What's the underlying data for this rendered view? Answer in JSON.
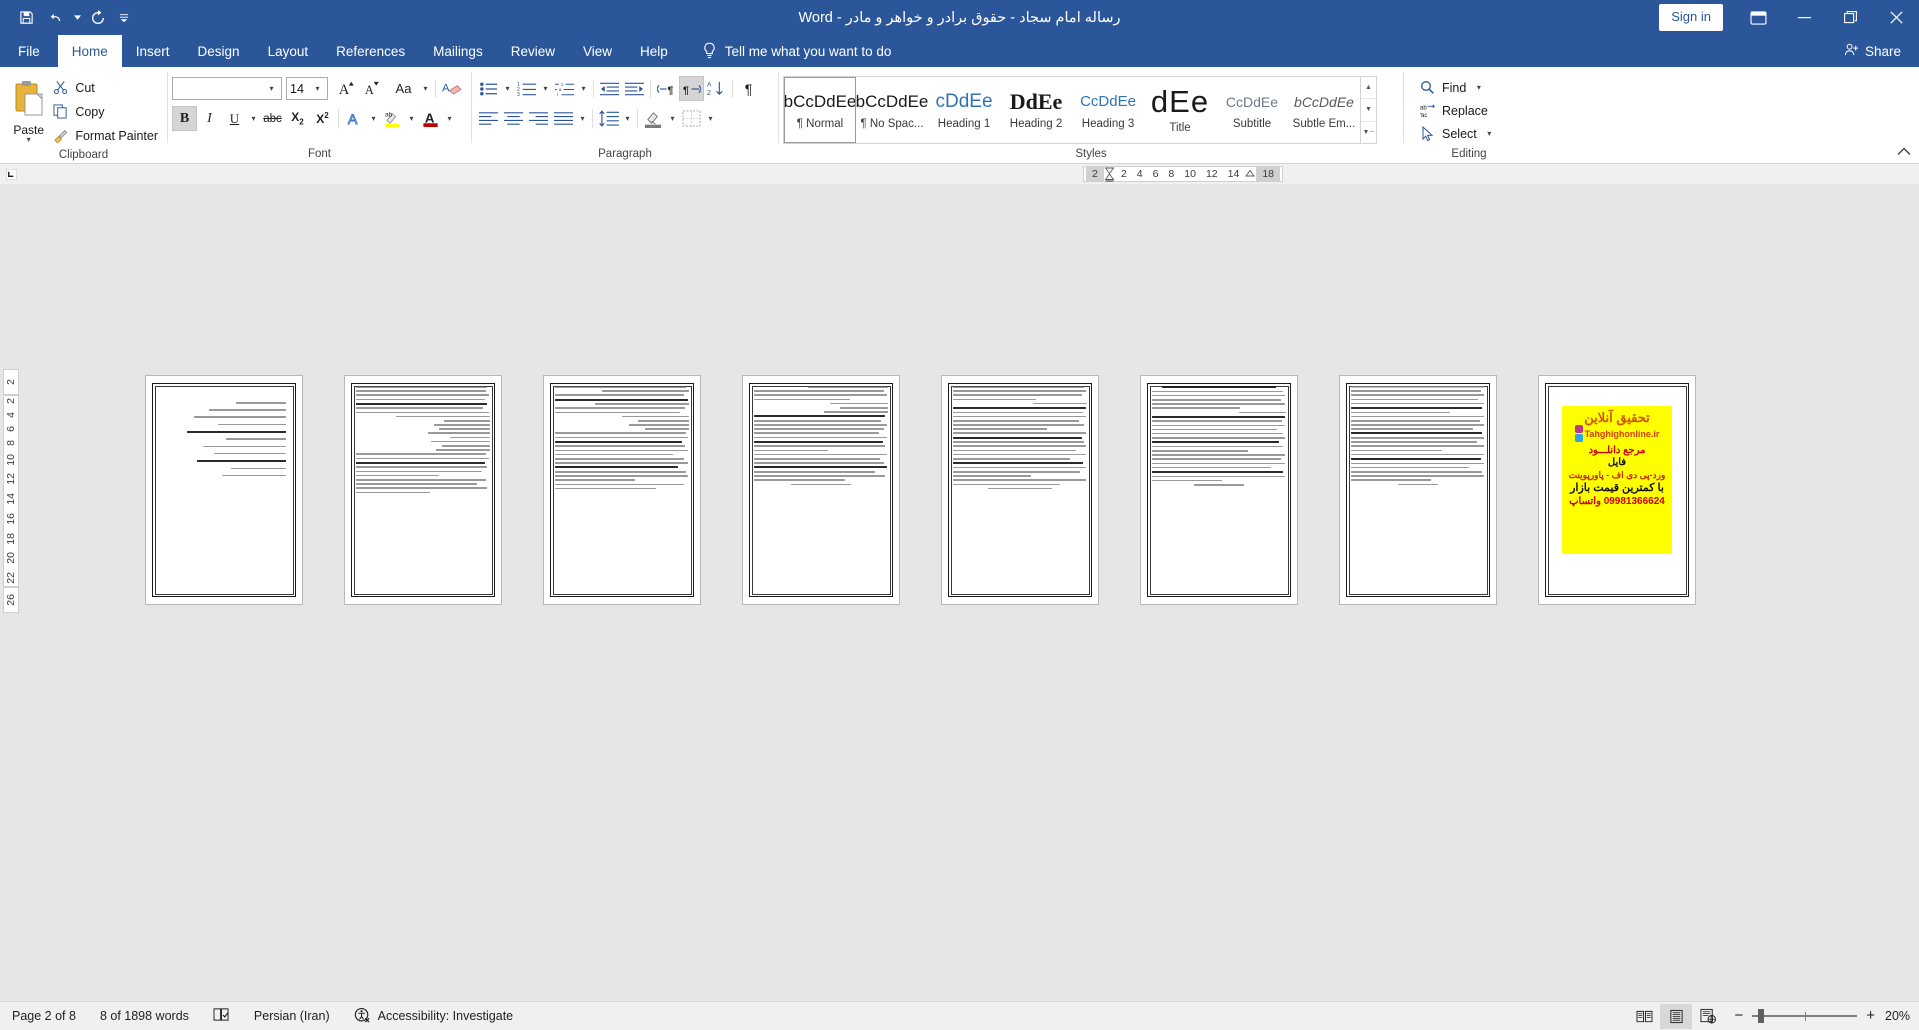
{
  "titlebar": {
    "document_title": "رساله امام سجاد - حقوق برادر و خواهر و مادر  -  Word",
    "quick_access": [
      {
        "name": "save-icon",
        "label": "Save"
      },
      {
        "name": "undo-icon",
        "label": "Undo"
      },
      {
        "name": "redo-icon",
        "label": "Redo"
      },
      {
        "name": "customize-qat-icon",
        "label": "Customize Quick Access Toolbar"
      }
    ],
    "sign_in": "Sign in",
    "ribbon_display_options": "Ribbon Display Options",
    "minimize": "Minimize",
    "restore": "Restore Down",
    "close": "Close"
  },
  "tabs": [
    {
      "label": "File",
      "active": false
    },
    {
      "label": "Home",
      "active": true
    },
    {
      "label": "Insert",
      "active": false
    },
    {
      "label": "Design",
      "active": false
    },
    {
      "label": "Layout",
      "active": false
    },
    {
      "label": "References",
      "active": false
    },
    {
      "label": "Mailings",
      "active": false
    },
    {
      "label": "Review",
      "active": false
    },
    {
      "label": "View",
      "active": false
    },
    {
      "label": "Help",
      "active": false
    }
  ],
  "tell_me": "Tell me what you want to do",
  "share": "Share",
  "ribbon": {
    "clipboard": {
      "group_label": "Clipboard",
      "paste": "Paste",
      "cut": "Cut",
      "copy": "Copy",
      "format_painter": "Format Painter"
    },
    "font": {
      "group_label": "Font",
      "font_name_value": "",
      "font_name_placeholder": "",
      "font_size_value": "14",
      "grow_font": "Increase Font Size",
      "shrink_font": "Decrease Font Size",
      "change_case": "Aa",
      "clear_formatting": "Clear All Formatting",
      "bold": "B",
      "italic": "I",
      "underline": "U",
      "strikethrough": "abc",
      "subscript": "X₂",
      "superscript": "X²",
      "text_effects": "A",
      "highlight": "Text Highlight Color",
      "font_color": "A"
    },
    "paragraph": {
      "group_label": "Paragraph",
      "bullets": "Bullets",
      "numbering": "Numbering",
      "multilevel": "Multilevel List",
      "decrease_indent": "Decrease Indent",
      "increase_indent": "Increase Indent",
      "ltr_text": "Left-to-Right Text Direction",
      "rtl_text": "Right-to-Left Text Direction",
      "sort": "Sort",
      "show_marks": "Show/Hide ¶",
      "align_left": "Align Left",
      "align_center": "Center",
      "align_right": "Align Right",
      "justify": "Justify",
      "line_spacing": "Line and Paragraph Spacing",
      "shading": "Shading",
      "borders": "Borders"
    },
    "styles": {
      "group_label": "Styles",
      "items": [
        {
          "preview": "bCcDdEe",
          "name": "¶ Normal",
          "selected": true
        },
        {
          "preview": "bCcDdEe",
          "name": "¶ No Spac...",
          "selected": false
        },
        {
          "preview": "cDdEe",
          "name": "Heading 1",
          "selected": false
        },
        {
          "preview": "DdEe",
          "name": "Heading 2",
          "selected": false
        },
        {
          "preview": "CcDdEe",
          "name": "Heading 3",
          "selected": false
        },
        {
          "preview": "dEe",
          "name": "Title",
          "selected": false
        },
        {
          "preview": "CcDdEe",
          "name": "Subtitle",
          "selected": false
        },
        {
          "preview": "bCcDdEe",
          "name": "Subtle Em...",
          "selected": false
        }
      ]
    },
    "editing": {
      "group_label": "Editing",
      "find": "Find",
      "replace": "Replace",
      "select": "Select"
    },
    "collapse_ribbon": "Collapse the Ribbon"
  },
  "ruler": {
    "horizontal_ticks": [
      "18",
      "14",
      "12",
      "10",
      "8",
      "6",
      "4",
      "2",
      "2"
    ],
    "vertical_ticks_top": [
      "2"
    ],
    "vertical_ticks": [
      "2",
      "4",
      "6",
      "8",
      "10",
      "12",
      "14",
      "16",
      "18",
      "20",
      "22"
    ],
    "vertical_ticks_bottom": [
      "26"
    ],
    "tab_stop_selector": "Left Tab"
  },
  "document": {
    "page_count_visible": 8,
    "pages": [
      {
        "page_label": "",
        "type": "text"
      },
      {
        "page_label": "",
        "type": "text"
      },
      {
        "page_label": "",
        "type": "text"
      },
      {
        "page_label": "",
        "type": "text"
      },
      {
        "page_label": "",
        "type": "text"
      },
      {
        "page_label": "",
        "type": "text"
      },
      {
        "page_label": "",
        "type": "text"
      },
      {
        "page_label": "",
        "type": "ad"
      }
    ],
    "ad_page": {
      "line1": "تحقیق آنلاین",
      "line2": "Tahghighonline.ir",
      "line3": "مرجع دانلـــود",
      "line4": "فایل",
      "line5": "ورد-پی دی اف - پاورپوینت",
      "line6": "با کمترین قیمت بازار",
      "line7": "09981366624 واتساپ",
      "background_color": "#ffff00"
    }
  },
  "statusbar": {
    "page": "Page 2 of 8",
    "words": "8 of 1898 words",
    "proofing": "Proofing errors",
    "language": "Persian (Iran)",
    "accessibility": "Accessibility: Investigate",
    "views": [
      {
        "name": "read-mode",
        "label": "Read Mode",
        "active": false
      },
      {
        "name": "print-layout",
        "label": "Print Layout",
        "active": true
      },
      {
        "name": "web-layout",
        "label": "Web Layout",
        "active": false
      }
    ],
    "zoom_out": "Zoom Out",
    "zoom_in": "Zoom In",
    "zoom_level": "20%"
  },
  "colors": {
    "accent": "#2b579a",
    "ribbon_bg": "#ffffff",
    "canvas_bg": "#e6e6e6",
    "status_bg": "#f0f0f0",
    "highlight_yellow": "#ffff00",
    "font_color_red": "#c00000"
  }
}
